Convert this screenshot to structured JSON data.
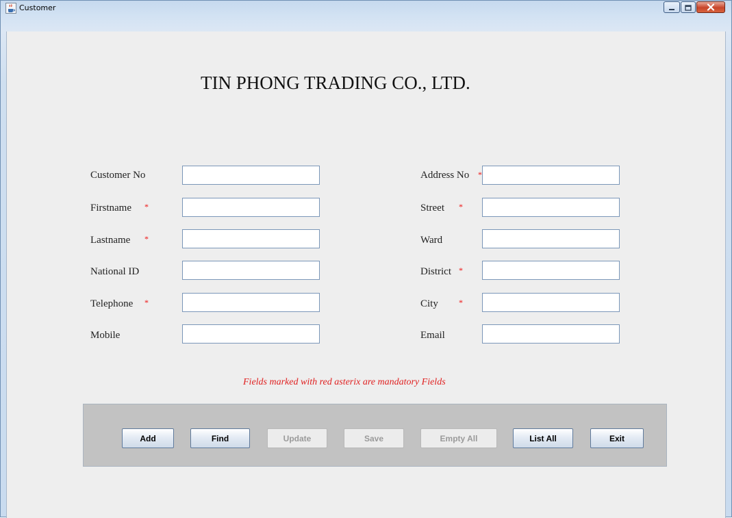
{
  "window": {
    "title": "Customer"
  },
  "header": {
    "company": "TIN PHONG TRADING CO., LTD."
  },
  "form": {
    "left": [
      {
        "label": "Customer No",
        "required": false,
        "value": ""
      },
      {
        "label": "Firstname",
        "required": true,
        "value": ""
      },
      {
        "label": "Lastname",
        "required": true,
        "value": ""
      },
      {
        "label": "National ID",
        "required": false,
        "value": ""
      },
      {
        "label": "Telephone",
        "required": true,
        "value": ""
      },
      {
        "label": "Mobile",
        "required": false,
        "value": ""
      }
    ],
    "right": [
      {
        "label": "Address No",
        "required": true,
        "value": ""
      },
      {
        "label": "Street",
        "required": true,
        "value": ""
      },
      {
        "label": "Ward",
        "required": false,
        "value": ""
      },
      {
        "label": "District",
        "required": true,
        "value": ""
      },
      {
        "label": "City",
        "required": true,
        "value": ""
      },
      {
        "label": "Email",
        "required": false,
        "value": ""
      }
    ],
    "asterisk": "*"
  },
  "note": "Fields marked with red asterix are mandatory Fields",
  "buttons": {
    "add": "Add",
    "find": "Find",
    "update": "Update",
    "save": "Save",
    "empty_all": "Empty All",
    "list_all": "List All",
    "exit": "Exit"
  },
  "colors": {
    "required_marker": "#e11111",
    "note_text": "#e02020",
    "client_bg": "#eeeeee",
    "button_panel_bg": "#c2c2c2",
    "close_button": "#c8452b"
  },
  "icons": {
    "app": "java-cup-icon",
    "minimize": "minimize-icon",
    "maximize": "maximize-icon",
    "close": "close-icon"
  }
}
